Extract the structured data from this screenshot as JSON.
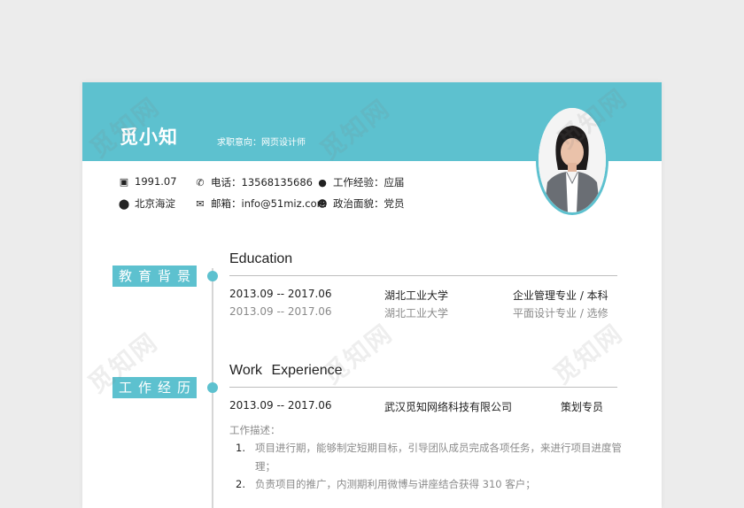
{
  "watermark": "觅知网",
  "header": {
    "name": "觅小知",
    "intent": "求职意向：网页设计师"
  },
  "info": {
    "birth": "1991.07",
    "phone_label": "电话：",
    "phone": "13568135686",
    "exp_label": "工作经验：",
    "exp": "应届",
    "location": "北京海淀",
    "email_label": "邮箱：",
    "email": "info@51miz.com",
    "politics_label": "政治面貌：",
    "politics": "党员"
  },
  "education": {
    "tag": "教育背景",
    "title": "Education",
    "entries": [
      {
        "period": "2013.09 -- 2017.06",
        "school": "湖北工业大学",
        "major": "企业管理专业 / 本科"
      },
      {
        "period": "2013.09 -- 2017.06",
        "school": "湖北工业大学",
        "major": "平面设计专业 / 选修"
      }
    ]
  },
  "work": {
    "tag": "工作经历",
    "title": "Work Experience",
    "entry": {
      "period": "2013.09 -- 2017.06",
      "company": "武汉觅知网络科技有限公司",
      "role": "策划专员"
    },
    "desc_label": "工作描述：",
    "items": [
      {
        "num": "1.",
        "text": "项目进行期，能够制定短期目标，引导团队成员完成各项任务，来进行项目进度管理；"
      },
      {
        "num": "2.",
        "text": "负责项目的推广，内测期利用微博与讲座结合获得 310 客户；"
      }
    ]
  },
  "colors": {
    "accent": "#5dc1cf",
    "paper": "#ffffff",
    "background": "#ececec"
  },
  "icons": [
    "calendar-icon",
    "phone-icon",
    "chat-icon",
    "location-icon",
    "mail-icon",
    "person-icon"
  ]
}
